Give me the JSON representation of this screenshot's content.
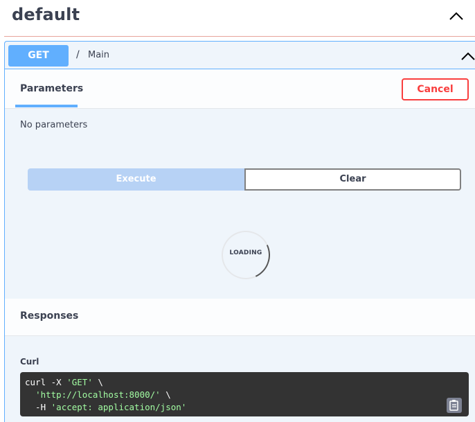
{
  "tag": {
    "title": "default"
  },
  "operation": {
    "method": "GET",
    "path_separator": "/",
    "path": "Main"
  },
  "parameters": {
    "tab_label": "Parameters",
    "cancel_label": "Cancel",
    "empty_text": "No parameters"
  },
  "actions": {
    "execute_label": "Execute",
    "clear_label": "Clear"
  },
  "loading": {
    "text": "LOADING"
  },
  "responses": {
    "title": "Responses",
    "curl_label": "Curl",
    "curl": {
      "line1_prefix": "curl -X ",
      "line1_method": "'GET'",
      "line1_suffix": " \\",
      "line2_indent": "  ",
      "line2_url": "'http://localhost:8000/'",
      "line2_suffix": " \\",
      "line3_prefix": "  -H ",
      "line3_header": "'accept: application/json'"
    }
  },
  "colors": {
    "get_accent": "#61affe",
    "cancel_red": "#f93e3e",
    "execute_disabled": "#b7d2f5",
    "code_bg": "#333333",
    "code_string": "#a2fca2"
  },
  "icons": {
    "tag_toggle": "chevron-up-icon",
    "summary_toggle": "chevron-up-icon",
    "copy": "clipboard-icon"
  }
}
